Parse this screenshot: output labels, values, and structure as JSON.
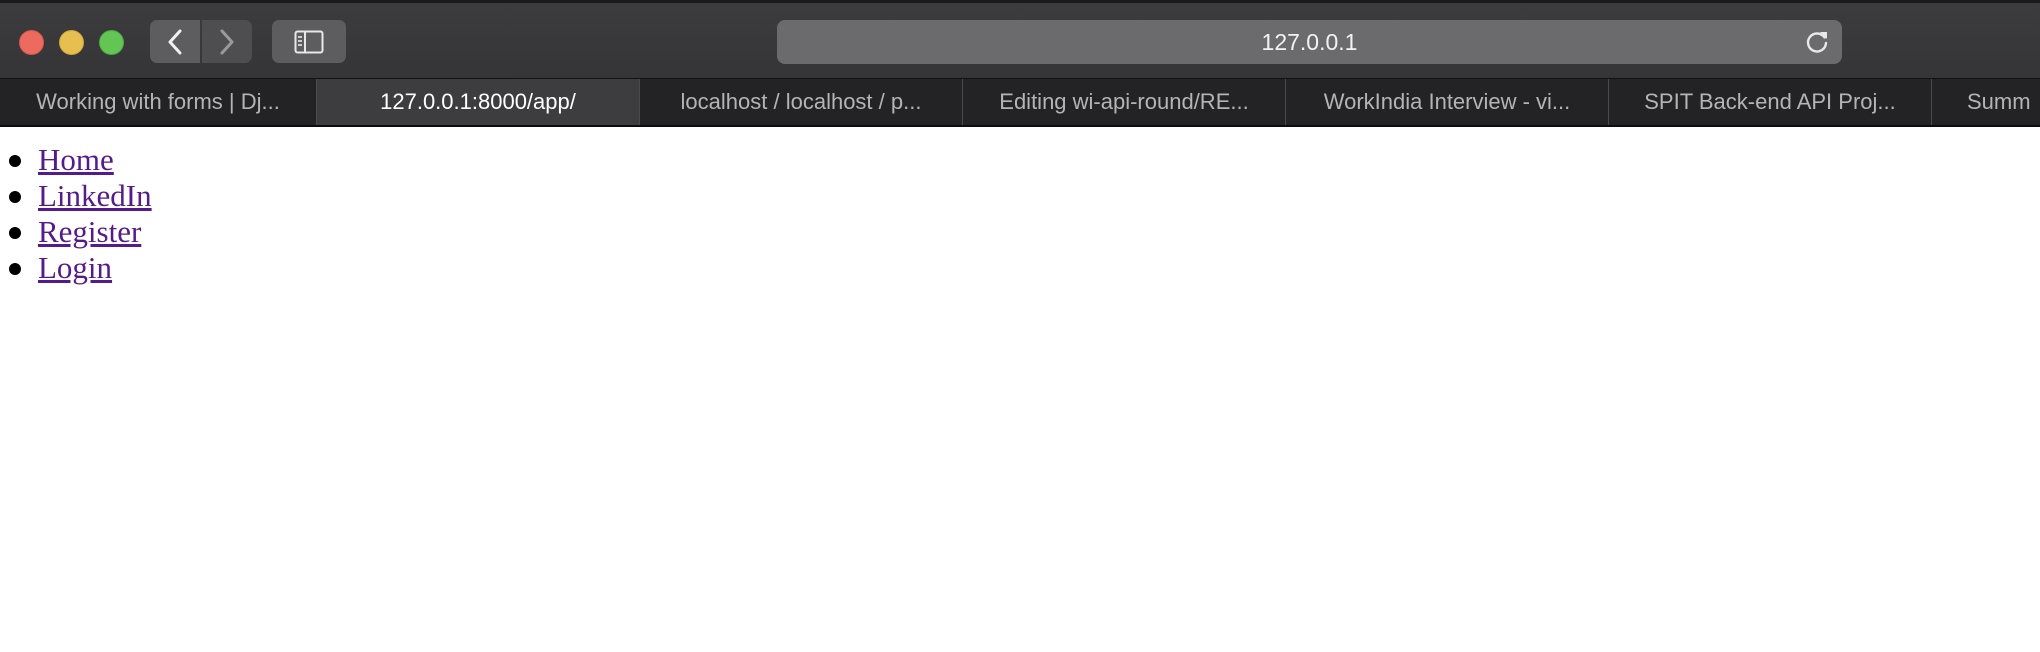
{
  "address_bar": {
    "url": "127.0.0.1"
  },
  "tabs": [
    {
      "label": "Working with forms | Dj...",
      "active": false
    },
    {
      "label": "127.0.0.1:8000/app/",
      "active": true
    },
    {
      "label": "localhost / localhost / p...",
      "active": false
    },
    {
      "label": "Editing wi-api-round/RE...",
      "active": false
    },
    {
      "label": "WorkIndia Interview - vi...",
      "active": false
    },
    {
      "label": "SPIT Back-end API Proj...",
      "active": false
    },
    {
      "label": "Summ",
      "active": false
    }
  ],
  "page": {
    "links": [
      {
        "label": "Home"
      },
      {
        "label": "LinkedIn"
      },
      {
        "label": "Register"
      },
      {
        "label": "Login"
      }
    ]
  },
  "colors": {
    "toolbar": "#3a3a3c",
    "tabbar": "#232325",
    "active_tab": "#3d3d40",
    "visited_link": "#551a8b",
    "close_button": "#ed6a5e",
    "minimize_button": "#e6bf50",
    "maximize_button": "#62c554"
  },
  "icons": {
    "back": "chevron-left-icon",
    "forward": "chevron-right-icon",
    "sidebar": "sidebar-icon",
    "reload": "reload-icon"
  }
}
